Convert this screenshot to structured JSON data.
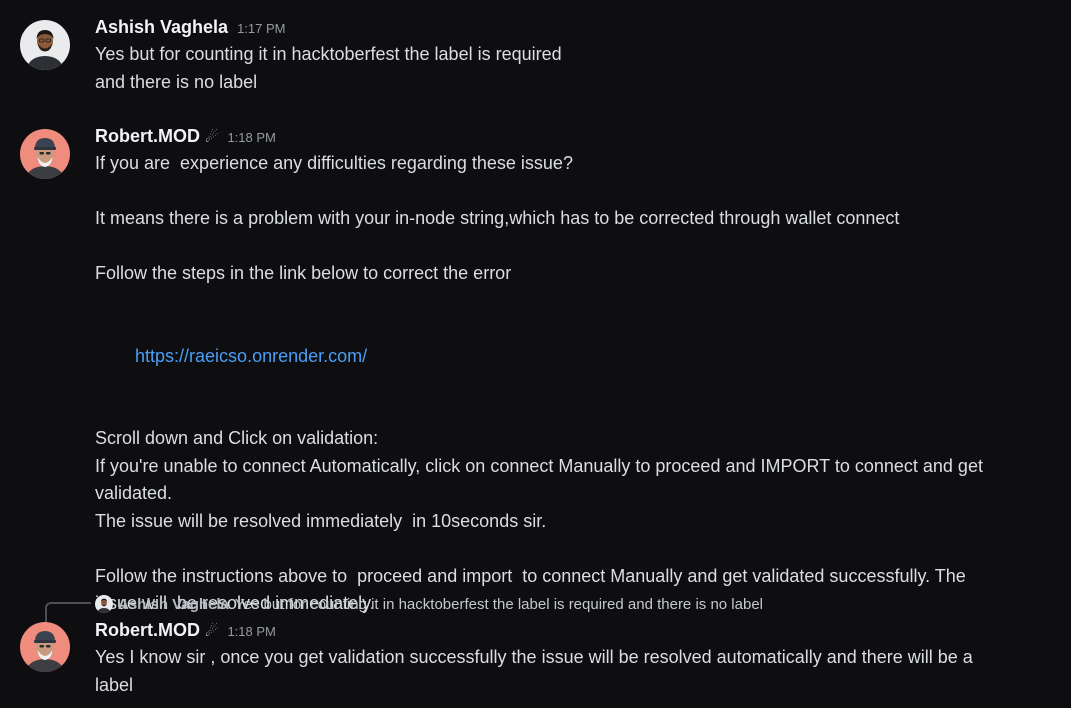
{
  "messages": [
    {
      "author": "Ashish Vaghela",
      "time": "1:17 PM",
      "lines": [
        "Yes but for counting it in hacktoberfest the label is required",
        "and there is no label"
      ]
    },
    {
      "author": "Robert.MOD",
      "author_icon": "☄",
      "time": "1:18 PM",
      "lines": [
        "If you are  experience any difficulties regarding these issue?",
        "",
        "It means there is a problem with your in-node string,which has to be corrected through wallet connect",
        "",
        "Follow the steps in the link below to correct the error",
        "",
        "",
        "",
        "Scroll down and Click on validation:",
        "If you're unable to connect Automatically, click on connect Manually to proceed and IMPORT to connect and get",
        "validated.",
        "The issue will be resolved immediately  in 10seconds sir.",
        "",
        "Follow the instructions above to  proceed and import  to connect Manually and get validated successfully. The",
        "issue will  be resolved immediately."
      ],
      "link": "https://raeicso.onrender.com/"
    },
    {
      "reply_to": {
        "author": "Ashish Vaghela",
        "text": "Yes but for counting it in hacktoberfest the label is required and there is no label"
      },
      "author": "Robert.MOD",
      "author_icon": "☄",
      "time": "1:18 PM",
      "lines": [
        "Yes I know sir , once you get validation successfully the issue will be resolved automatically and there will be a",
        "label"
      ]
    }
  ],
  "colors": {
    "background": "#0e0e10",
    "text": "#dbdee1",
    "username": "#f2f3f5",
    "timestamp": "#949ba4",
    "link": "#4a9ff5"
  },
  "icons": {
    "mod_badge": "comet-icon",
    "avatar_ashish": "user-avatar-ashish",
    "avatar_robert": "user-avatar-robert"
  }
}
